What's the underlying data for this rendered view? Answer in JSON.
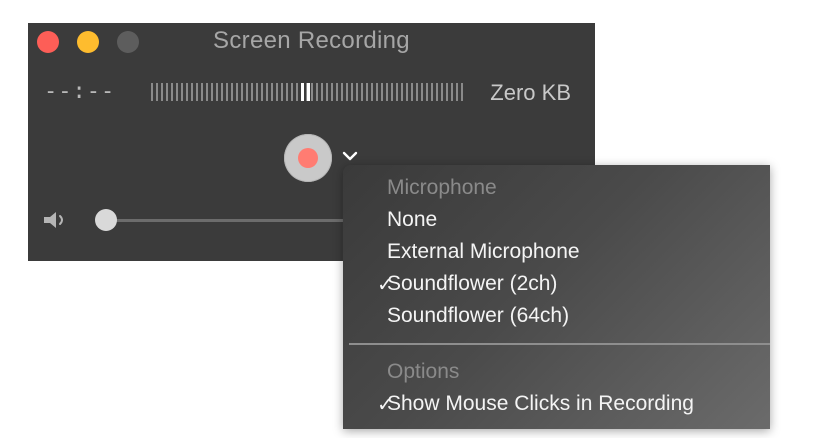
{
  "window": {
    "title": "Screen Recording",
    "elapsed_time": "--:--",
    "file_size": "Zero KB",
    "volume_level": 0.03
  },
  "menu": {
    "microphone_header": "Microphone",
    "microphone_options": [
      {
        "label": "None",
        "checked": false
      },
      {
        "label": "External Microphone",
        "checked": false
      },
      {
        "label": "Soundflower (2ch)",
        "checked": true
      },
      {
        "label": "Soundflower (64ch)",
        "checked": false
      }
    ],
    "options_header": "Options",
    "option_items": [
      {
        "label": "Show Mouse Clicks in Recording",
        "checked": true
      }
    ],
    "check_glyph": "✓"
  },
  "colors": {
    "window_bg": "#3b3b3b",
    "close_button": "#fd5e57",
    "minimize_button": "#febc2e",
    "zoom_button_disabled": "#5d5d5d",
    "record_dot": "#ff7c72"
  }
}
